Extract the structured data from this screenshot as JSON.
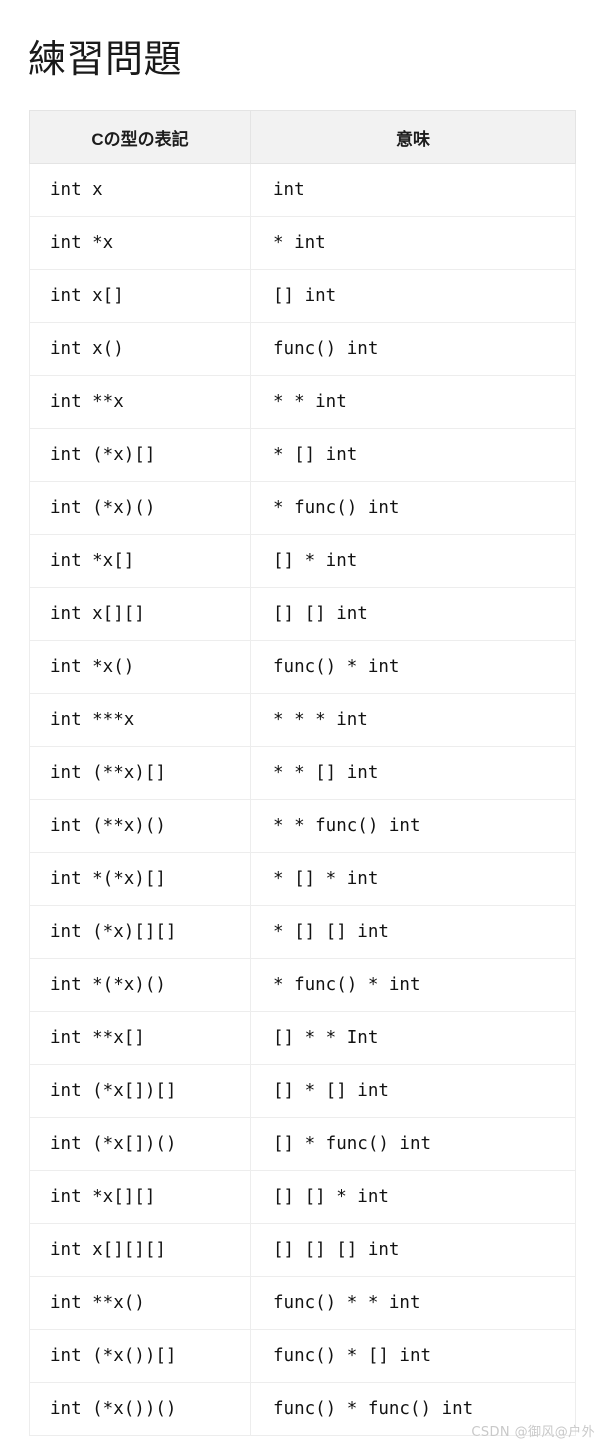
{
  "page": {
    "title": "練習問題",
    "watermark": "CSDN @御风@户外"
  },
  "table": {
    "headers": [
      "Cの型の表記",
      "意味"
    ],
    "rows": [
      {
        "declaration": "int x",
        "meaning": "int"
      },
      {
        "declaration": "int *x",
        "meaning": "* int"
      },
      {
        "declaration": "int x[]",
        "meaning": "[] int"
      },
      {
        "declaration": "int x()",
        "meaning": "func() int"
      },
      {
        "declaration": "int **x",
        "meaning": "* * int"
      },
      {
        "declaration": "int (*x)[]",
        "meaning": "* [] int"
      },
      {
        "declaration": "int (*x)()",
        "meaning": "* func() int"
      },
      {
        "declaration": "int *x[]",
        "meaning": "[] * int"
      },
      {
        "declaration": "int x[][]",
        "meaning": "[] [] int"
      },
      {
        "declaration": "int *x()",
        "meaning": "func() * int"
      },
      {
        "declaration": "int ***x",
        "meaning": "* * * int"
      },
      {
        "declaration": "int (**x)[]",
        "meaning": "* * [] int"
      },
      {
        "declaration": "int (**x)()",
        "meaning": "* * func() int"
      },
      {
        "declaration": "int *(*x)[]",
        "meaning": "* [] * int"
      },
      {
        "declaration": "int (*x)[][]",
        "meaning": "* [] [] int"
      },
      {
        "declaration": "int *(*x)()",
        "meaning": "* func() * int"
      },
      {
        "declaration": "int **x[]",
        "meaning": "[] * * Int"
      },
      {
        "declaration": "int (*x[])[]",
        "meaning": "[] * [] int"
      },
      {
        "declaration": "int (*x[])()",
        "meaning": "[] * func() int"
      },
      {
        "declaration": "int *x[][]",
        "meaning": "[] [] * int"
      },
      {
        "declaration": "int x[][][]",
        "meaning": "[] [] [] int"
      },
      {
        "declaration": "int **x()",
        "meaning": "func() * * int"
      },
      {
        "declaration": "int (*x())[]",
        "meaning": "func() * [] int"
      },
      {
        "declaration": "int (*x())()",
        "meaning": "func() * func() int"
      }
    ]
  }
}
